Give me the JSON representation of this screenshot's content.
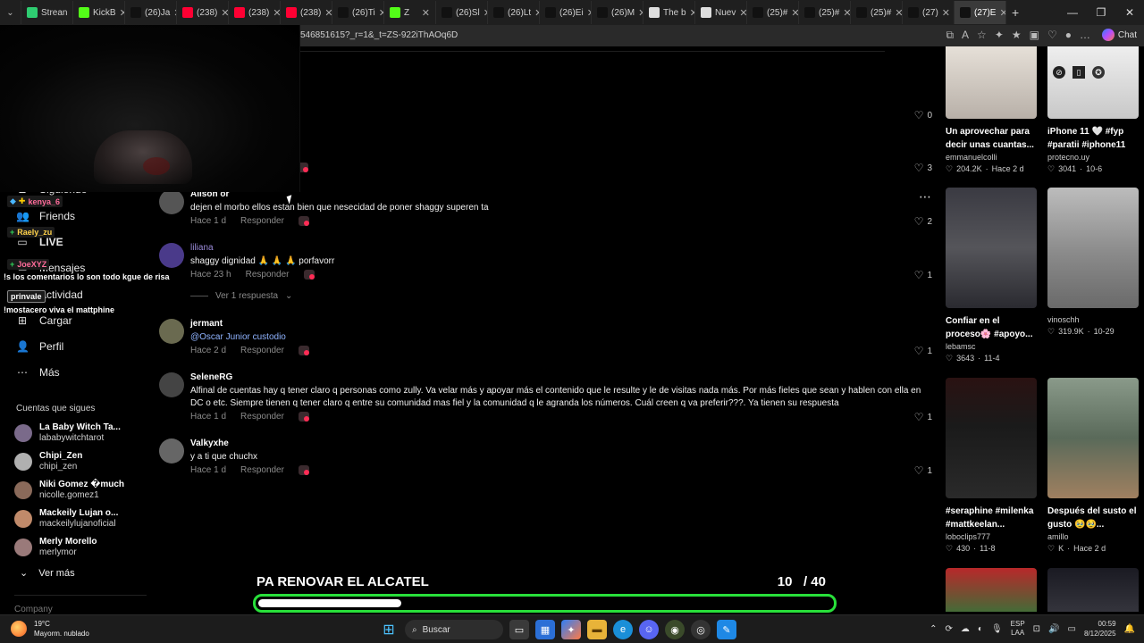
{
  "browser": {
    "tabs": [
      {
        "label": "Strean",
        "icon": "#2ecc71"
      },
      {
        "label": "KickB",
        "icon": "#53fc18"
      },
      {
        "label": "(26)Ja",
        "icon": "#111111"
      },
      {
        "label": "(238)",
        "icon": "#ff0033"
      },
      {
        "label": "(238)",
        "icon": "#ff0033"
      },
      {
        "label": "(238)",
        "icon": "#ff0033"
      },
      {
        "label": "(26)Ti",
        "icon": "#111111"
      },
      {
        "label": "Z",
        "icon": "#53fc18"
      },
      {
        "label": "(26)Sl",
        "icon": "#111111"
      },
      {
        "label": "(26)Lt",
        "icon": "#111111"
      },
      {
        "label": "(26)Ei",
        "icon": "#111111"
      },
      {
        "label": "(26)M",
        "icon": "#111111"
      },
      {
        "label": "The b",
        "icon": "#dddddd"
      },
      {
        "label": "Nuev",
        "icon": "#dddddd"
      },
      {
        "label": "(25)#",
        "icon": "#111111"
      },
      {
        "label": "(25)#",
        "icon": "#111111"
      },
      {
        "label": "(25)#",
        "icon": "#111111"
      },
      {
        "label": "(27)",
        "icon": "#111111"
      },
      {
        "label": "(27)E",
        "icon": "#111111"
      }
    ],
    "url": "546851615?_r=1&_t=ZS-922iThAOq6D",
    "chat_label": "Chat"
  },
  "stream_overlay": {
    "chat": [
      {
        "user": "kenya_6",
        "text": ""
      },
      {
        "user": "Raely_zu",
        "text": ""
      },
      {
        "user": "JoeXYZ",
        "text": ""
      },
      {
        "user": "",
        "text": "!s los comentarios lo son todo kgue de risa"
      },
      {
        "user": "prinvale",
        "text": ""
      },
      {
        "user": "",
        "text": "!mostacero viva el mattphine"
      }
    ],
    "goal": {
      "title": "PA RENOVAR EL ALCATEL",
      "current": "10",
      "target": "/ 40",
      "progress": 0.25
    }
  },
  "sidebar": {
    "nav": [
      {
        "label": "Siguiendo",
        "icon": "following-icon"
      },
      {
        "label": "Friends",
        "icon": "friends-icon"
      },
      {
        "label": "LIVE",
        "icon": "live-icon"
      },
      {
        "label": "Mensajes",
        "icon": "messages-icon"
      },
      {
        "label": "Actividad",
        "icon": "activity-icon"
      },
      {
        "label": "Cargar",
        "icon": "upload-icon"
      },
      {
        "label": "Perfil",
        "icon": "profile-icon"
      },
      {
        "label": "Más",
        "icon": "more-icon"
      }
    ],
    "following_title": "Cuentas que sigues",
    "following": [
      {
        "name": "La Baby Witch Ta...",
        "handle": "lababywitchtarot",
        "color": "#7a6a8a"
      },
      {
        "name": "Chipi_Zen",
        "handle": "chipi_zen",
        "color": "#b0b0b0"
      },
      {
        "name": "Niki Gomez �much",
        "handle": "nicolle.gomez1",
        "color": "#8a6a5a"
      },
      {
        "name": "Mackeily Lujan o...",
        "handle": "mackeilylujanoficial",
        "color": "#c08a6a"
      },
      {
        "name": "Merly Morello",
        "handle": "merlymor",
        "color": "#9a7a7a"
      }
    ],
    "see_more": "Ver más",
    "company": "Company"
  },
  "comments": [
    {
      "user": "",
      "text": "",
      "time": "",
      "likes": "0"
    },
    {
      "user": "",
      "text": "",
      "time": "",
      "likes": "3"
    },
    {
      "user": "Alison or",
      "text": "dejen el morbo ellos estan bien que nesecidad de poner shaggy superen ta",
      "time": "Hace 1 d",
      "likes": "2",
      "color": "#666"
    },
    {
      "user": "liliana",
      "text": "shaggy dignidad 🙏 🙏 🙏 porfavorr",
      "time": "Hace 23 h",
      "likes": "1",
      "color": "#6a5aa8"
    },
    {
      "user": "jermant",
      "text": "@Oscar Junior custodio",
      "time": "Hace 2 d",
      "likes": "1",
      "color": "#8a8a6a"
    },
    {
      "user": "SeleneRG",
      "text": "Alfinal de cuentas hay q tener claro q personas como zully. Va velar más y apoyar más el contenido que le resulte y le de visitas nada más. Por más fieles que sean y hablen con ella en DC o etc. Siempre tienen q tener claro q entre su comunidad mas fiel y la comunidad q le agranda los números. Cuál creen q va preferir???. Ya tienen su respuesta",
      "time": "Hace 1 d",
      "likes": "1",
      "color": "#555"
    },
    {
      "user": "Valkyxhe",
      "text": "y a ti que chuchx",
      "time": "Hace 1 d",
      "likes": "1",
      "color": "#777"
    }
  ],
  "reply_label": "Responder",
  "view_replies": "Ver 1 respuesta",
  "videos": [
    {
      "title": "Un aprovechar para decir unas cuantas...",
      "author": "emmanuelcolli",
      "views": "204.2K",
      "date": "Hace 2 d",
      "thumb": "#cfc8c0"
    },
    {
      "title": "iPhone 11 🤍 #fyp #paratii #iphone11",
      "author": "protecno.uy",
      "views": "3041",
      "date": "10-6",
      "thumb": "#d8d8d8"
    },
    {
      "title": "Confiar en el proceso🌸 #apoyo...",
      "author": "lebamsc",
      "views": "3643",
      "date": "11-4",
      "thumb": "#3a3a40"
    },
    {
      "title": "",
      "author": "vinoschh",
      "views": "319.9K",
      "date": "10-29",
      "thumb": "#8a8a8a"
    },
    {
      "title": "#seraphine #milenka #mattkeelan...",
      "author": "loboclips777",
      "views": "430",
      "date": "11-8",
      "thumb": "#2a1a1a"
    },
    {
      "title": "Después del susto el gusto 🥹🥹...",
      "author": "amillo",
      "views": "K",
      "date": "Hace 2 d",
      "thumb": "#7a8a7a"
    },
    {
      "title": "",
      "author": "",
      "views": "",
      "date": "",
      "thumb": "#b8282a"
    },
    {
      "title": "",
      "author": "",
      "views": "",
      "date": "",
      "thumb": "#2a2a30"
    }
  ],
  "taskbar": {
    "temp": "19°C",
    "weather": "Mayorm. nublado",
    "search": "Buscar",
    "lang1": "ESP",
    "lang2": "LAA",
    "time": "00:59",
    "date": "8/12/2025"
  }
}
